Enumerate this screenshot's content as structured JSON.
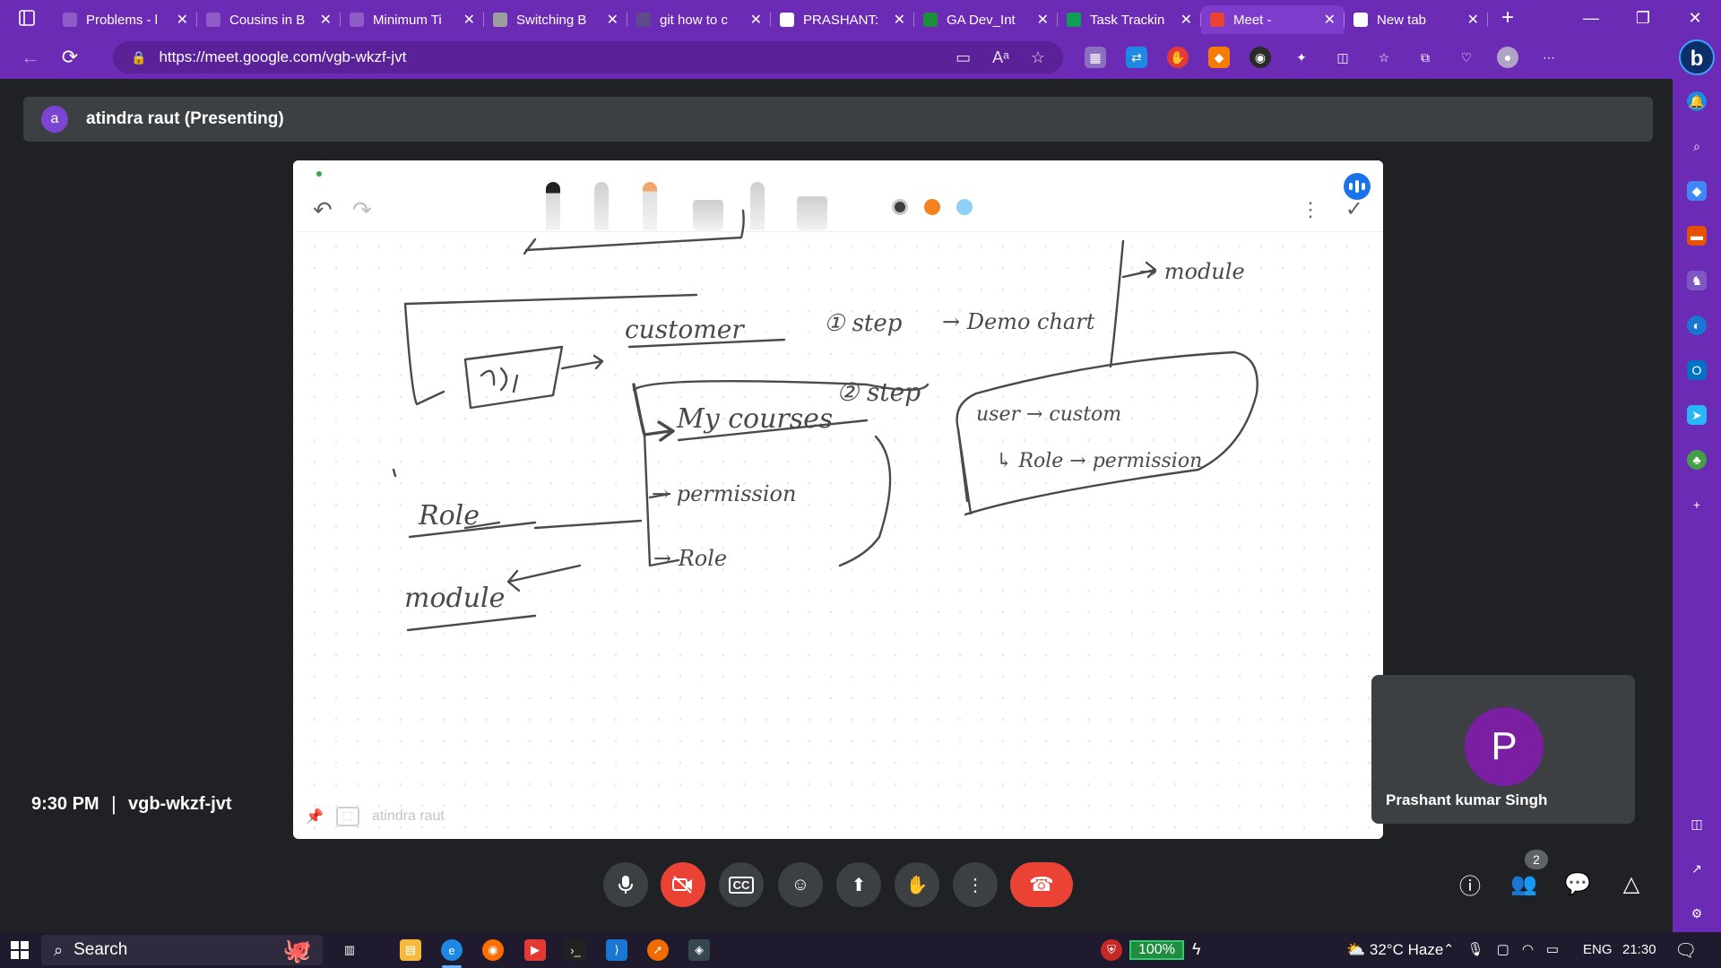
{
  "browser": {
    "tabs": [
      {
        "title": "Problems - l",
        "color": "#8e5cc7"
      },
      {
        "title": "Cousins in B",
        "color": "#8e5cc7"
      },
      {
        "title": "Minimum Ti",
        "color": "#8e5cc7"
      },
      {
        "title": "Switching B",
        "color": "#9e9e9e"
      },
      {
        "title": "git how to c",
        "color": "#5f4a8b"
      },
      {
        "title": "PRASHANT:",
        "color": "#ffffff"
      },
      {
        "title": "GA Dev_Int",
        "color": "#1e8e3e"
      },
      {
        "title": "Task Trackin",
        "color": "#0f9d58"
      },
      {
        "title": "Meet -",
        "color": "#ea4335",
        "active": true
      },
      {
        "title": "New tab",
        "color": "#ffffff"
      }
    ],
    "url": "https://meet.google.com/vgb-wkzf-jvt"
  },
  "meet": {
    "presenter": {
      "initial": "a",
      "label": "atindra raut (Presenting)"
    },
    "whiteboard": {
      "owner": "atindra raut",
      "swatches": [
        "#3c4043",
        "#f4811f",
        "#8fd0f7"
      ],
      "notes": {
        "customer": "customer",
        "step1": "① step",
        "demo": "→ Demo chart",
        "module_top": "→ module",
        "my_courses": "My courses",
        "step2": "② step",
        "permission": "→ permission",
        "role_right": "→ Role",
        "user_line": "user → custom",
        "role_line": "↳ Role → permission",
        "role_left": "Role",
        "module_left": "module"
      }
    },
    "participant": {
      "initial": "P",
      "name": "Prashant kumar Singh"
    },
    "meeting_time": "9:30 PM",
    "meeting_separator": "|",
    "meeting_code": "vgb-wkzf-jvt",
    "people_count": "2"
  },
  "taskbar": {
    "search_label": "Search",
    "battery": "100%",
    "weather": "32°C Haze",
    "language": "ENG",
    "clock": "21:30"
  }
}
